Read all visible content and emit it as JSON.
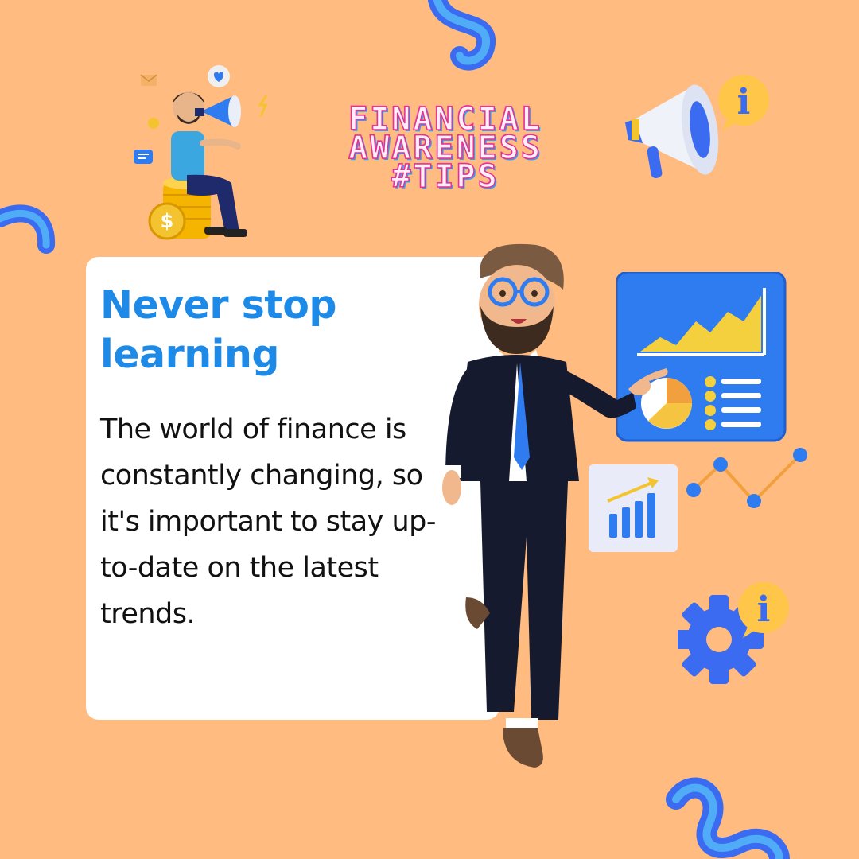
{
  "header": {
    "title_lines": [
      "FINANCIAL",
      "AWARENESS",
      "#TIPS"
    ]
  },
  "card": {
    "heading": "Never stop learning",
    "body": "The world of finance is constantly changing, so it's important to stay up-to-date on the latest trends."
  },
  "colors": {
    "background": "#FFBB80",
    "card": "#FFFFFF",
    "heading": "#1D8AE8",
    "body_text": "#111111",
    "accent_blue": "#2F7BF0",
    "accent_yellow": "#F4C430"
  },
  "icons": {
    "megaphone_man": "person-with-megaphone-icon",
    "megaphone_info": "megaphone-info-icon",
    "presenter": "businessman-presenter-illustration",
    "dashboard": "dashboard-chart-icon",
    "bar_growth": "bar-growth-icon",
    "line_graph": "line-graph-icon",
    "gear_info": "gear-info-icon",
    "squiggle": "squiggle-decoration-icon"
  }
}
